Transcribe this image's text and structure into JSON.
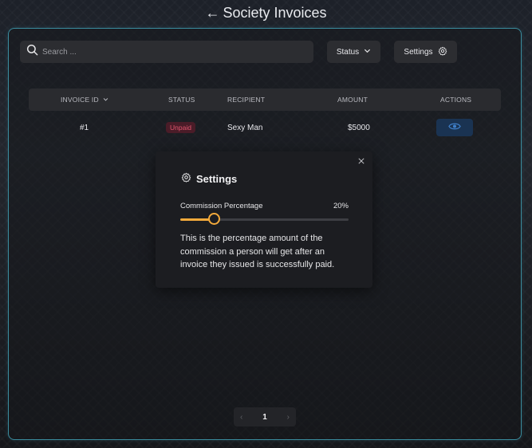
{
  "header": {
    "title": "Society Invoices",
    "back_arrow": "←"
  },
  "toolbar": {
    "search_placeholder": "Search ...",
    "status_label": "Status",
    "settings_label": "Settings"
  },
  "table": {
    "columns": [
      "INVOICE ID",
      "STATUS",
      "RECIPIENT",
      "AMOUNT",
      "ACTIONS"
    ],
    "rows": [
      {
        "id": "#1",
        "status": "Unpaid",
        "recipient": "Sexy Man",
        "amount": "$5000"
      }
    ]
  },
  "settings_modal": {
    "title": "Settings",
    "slider_label": "Commission Percentage",
    "slider_value_text": "20%",
    "commission_fraction": 0.2,
    "description": "This is the percentage amount of the commission a person will get after an invoice they issued is successfully paid."
  },
  "pagination": {
    "current_page": "1",
    "prev": "‹",
    "next": "›"
  },
  "colors": {
    "accent": "#f2a93b",
    "frame_border": "#3a8c9e",
    "unpaid_badge_text": "#e2566f",
    "view_button_bg": "#1a3352",
    "view_icon": "#3f7fc9"
  },
  "icons": [
    "search-icon",
    "chevron-down-icon",
    "gear-icon",
    "eye-icon",
    "close-icon",
    "chevron-left-icon",
    "chevron-right-icon"
  ]
}
